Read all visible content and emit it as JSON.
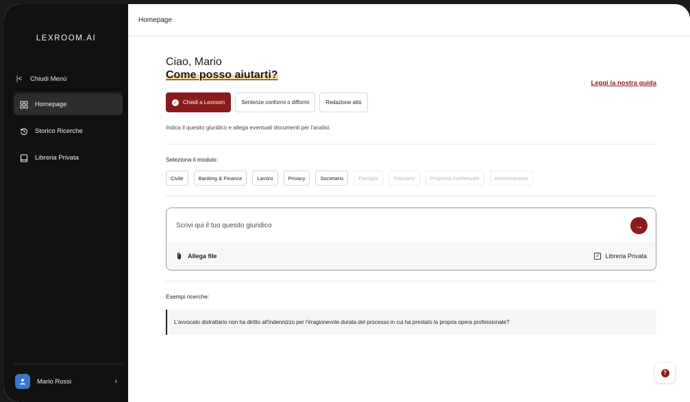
{
  "app": {
    "logo": "LEXROOM.AI"
  },
  "sidebar": {
    "toggle_label": "Chiudi Menù",
    "items": [
      {
        "label": "Homepage",
        "icon": "grid-icon",
        "active": true
      },
      {
        "label": "Storico Ricerche",
        "icon": "history-icon",
        "active": false
      },
      {
        "label": "Libreria Privata",
        "icon": "book-icon",
        "active": false
      }
    ],
    "user": {
      "name": "Mario Rossi"
    }
  },
  "topbar": {
    "title": "Homepage"
  },
  "main": {
    "greeting": "Ciao, Mario",
    "headline": "Come posso aiutarti?",
    "guide_link": "Leggi la nostra guida",
    "modes": [
      {
        "label": "Chiedi a Lexroom",
        "active": true
      },
      {
        "label": "Sentenze conformi o difformi",
        "active": false
      },
      {
        "label": "Redazione atto",
        "active": false
      }
    ],
    "hint": "Indica il quesito giuridico e allega eventuali documenti per l'analisi.",
    "module_label": "Seleziona il modulo:",
    "modules": [
      {
        "label": "Civile",
        "enabled": true
      },
      {
        "label": "Banking & Finance",
        "enabled": true
      },
      {
        "label": "Lavoro",
        "enabled": true
      },
      {
        "label": "Privacy",
        "enabled": true
      },
      {
        "label": "Societario",
        "enabled": true
      },
      {
        "label": "Famiglia",
        "enabled": false
      },
      {
        "label": "Tributario",
        "enabled": false
      },
      {
        "label": "Proprietà Intellettuale",
        "enabled": false
      },
      {
        "label": "Amministrativo",
        "enabled": false
      }
    ],
    "query": {
      "placeholder": "Scrivi qui il tuo quesito giuridico",
      "value": "",
      "attach_label": "Allega file",
      "library_label": "Libreria Privata",
      "library_checked": true
    },
    "examples_label": "Esempi ricerche:",
    "examples": [
      "L'avvocato distrattario non ha diritto all'indennizzo per l'irragionevole durata del processo in cui ha prestato la propria opera professionale?"
    ]
  },
  "colors": {
    "accent": "#8b1a1a",
    "highlight": "#f7d9a3",
    "sidebar": "#111111"
  }
}
